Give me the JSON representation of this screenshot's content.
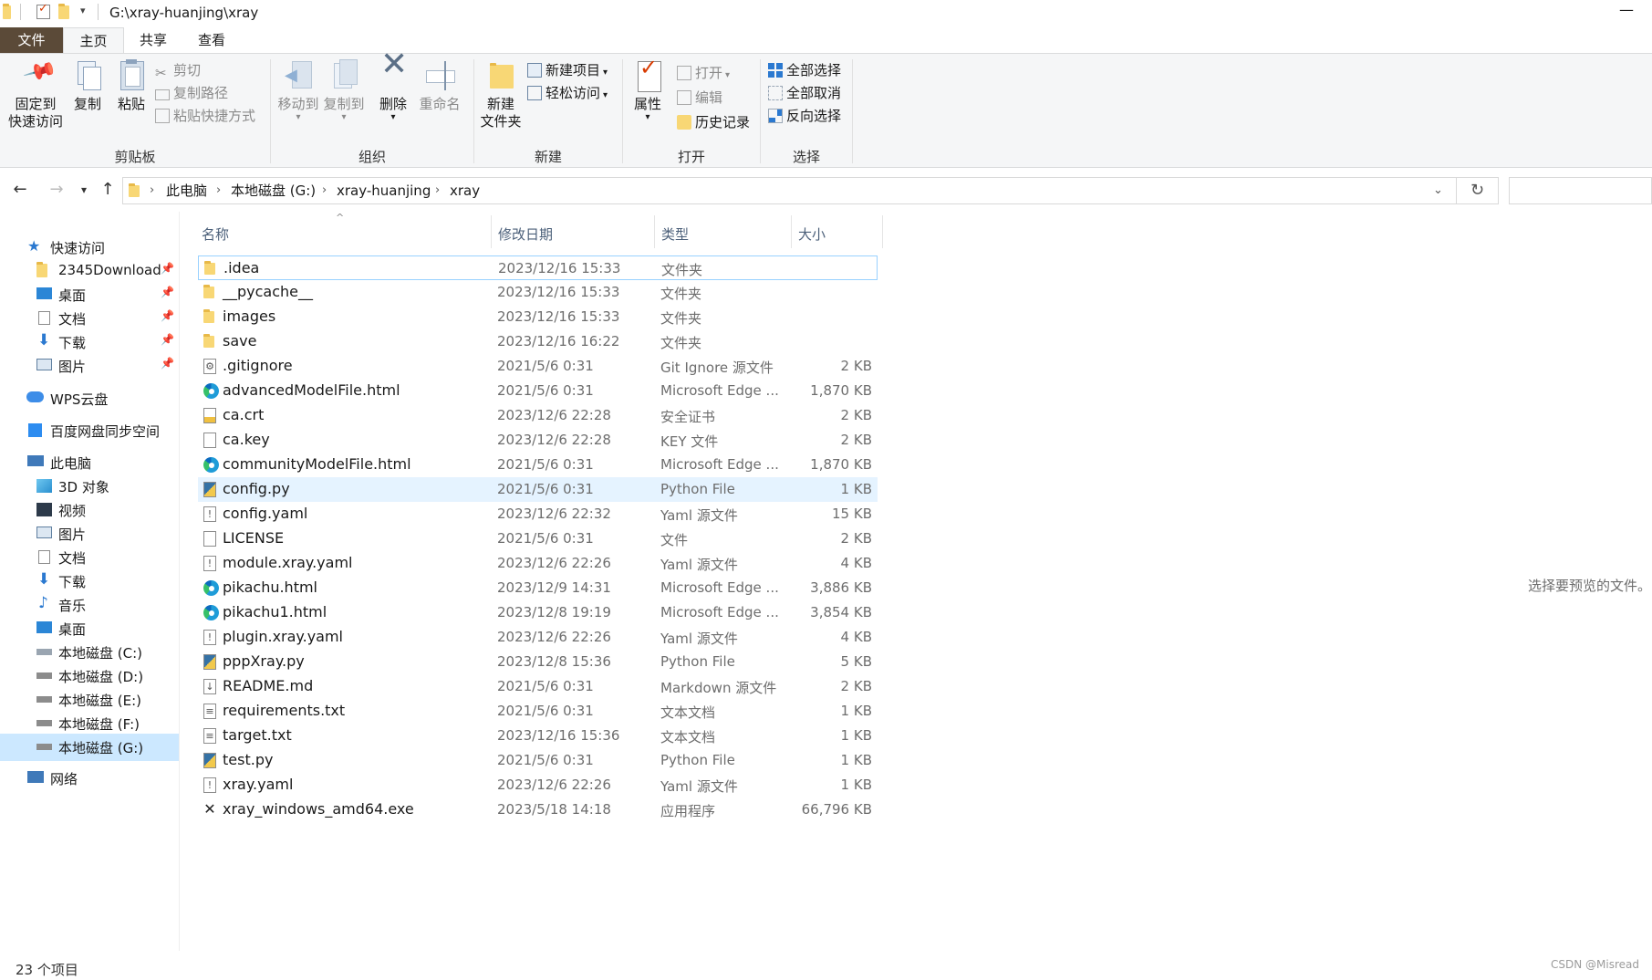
{
  "window": {
    "title": "G:\\xray-huanjing\\xray",
    "minimize_glyph": "—"
  },
  "ribbon": {
    "tabs": [
      "文件",
      "主页",
      "共享",
      "查看"
    ],
    "clipboard": {
      "pin_label_1": "固定到",
      "pin_label_2": "快速访问",
      "copy": "复制",
      "paste": "粘贴",
      "cut": "剪切",
      "copy_path": "复制路径",
      "paste_shortcut": "粘贴快捷方式",
      "group": "剪贴板"
    },
    "organize": {
      "move_to": "移动到",
      "copy_to": "复制到",
      "delete": "删除",
      "rename": "重命名",
      "group": "组织"
    },
    "new": {
      "new_folder_1": "新建",
      "new_folder_2": "文件夹",
      "new_item": "新建项目",
      "easy_access": "轻松访问",
      "group": "新建"
    },
    "open": {
      "properties": "属性",
      "open": "打开",
      "edit": "编辑",
      "history": "历史记录",
      "group": "打开"
    },
    "select": {
      "select_all": "全部选择",
      "select_none": "全部取消",
      "invert": "反向选择",
      "group": "选择"
    }
  },
  "address": {
    "crumbs": [
      "此电脑",
      "本地磁盘 (G:)",
      "xray-huanjing",
      "xray"
    ]
  },
  "nav": {
    "quick_access": "快速访问",
    "qa_items": [
      "2345Download",
      "桌面",
      "文档",
      "下载",
      "图片"
    ],
    "wps": "WPS云盘",
    "baidu": "百度网盘同步空间",
    "this_pc": "此电脑",
    "pc_items": [
      "3D 对象",
      "视频",
      "图片",
      "文档",
      "下载",
      "音乐",
      "桌面",
      "本地磁盘 (C:)",
      "本地磁盘 (D:)",
      "本地磁盘 (E:)",
      "本地磁盘 (F:)",
      "本地磁盘 (G:)"
    ],
    "network": "网络"
  },
  "columns": {
    "name": "名称",
    "date": "修改日期",
    "type": "类型",
    "size": "大小"
  },
  "files": [
    {
      "name": ".idea",
      "date": "2023/12/16 15:33",
      "type": "文件夹",
      "size": "",
      "icon": "folder-icon"
    },
    {
      "name": "__pycache__",
      "date": "2023/12/16 15:33",
      "type": "文件夹",
      "size": "",
      "icon": "folder-icon"
    },
    {
      "name": "images",
      "date": "2023/12/16 15:33",
      "type": "文件夹",
      "size": "",
      "icon": "folder-icon"
    },
    {
      "name": "save",
      "date": "2023/12/16 16:22",
      "type": "文件夹",
      "size": "",
      "icon": "folder-icon"
    },
    {
      "name": ".gitignore",
      "date": "2021/5/6 0:31",
      "type": "Git Ignore 源文件",
      "size": "2 KB",
      "icon": "settings-file-icon"
    },
    {
      "name": "advancedModelFile.html",
      "date": "2021/5/6 0:31",
      "type": "Microsoft Edge ...",
      "size": "1,870 KB",
      "icon": "edge-icon"
    },
    {
      "name": "ca.crt",
      "date": "2023/12/6 22:28",
      "type": "安全证书",
      "size": "2 KB",
      "icon": "certificate-icon"
    },
    {
      "name": "ca.key",
      "date": "2023/12/6 22:28",
      "type": "KEY 文件",
      "size": "2 KB",
      "icon": "blank-file-icon"
    },
    {
      "name": "communityModelFile.html",
      "date": "2021/5/6 0:31",
      "type": "Microsoft Edge ...",
      "size": "1,870 KB",
      "icon": "edge-icon"
    },
    {
      "name": "config.py",
      "date": "2021/5/6 0:31",
      "type": "Python File",
      "size": "1 KB",
      "icon": "python-file-icon"
    },
    {
      "name": "config.yaml",
      "date": "2023/12/6 22:32",
      "type": "Yaml 源文件",
      "size": "15 KB",
      "icon": "yaml-file-icon"
    },
    {
      "name": "LICENSE",
      "date": "2021/5/6 0:31",
      "type": "文件",
      "size": "2 KB",
      "icon": "blank-file-icon"
    },
    {
      "name": "module.xray.yaml",
      "date": "2023/12/6 22:26",
      "type": "Yaml 源文件",
      "size": "4 KB",
      "icon": "yaml-file-icon"
    },
    {
      "name": "pikachu.html",
      "date": "2023/12/9 14:31",
      "type": "Microsoft Edge ...",
      "size": "3,886 KB",
      "icon": "edge-icon"
    },
    {
      "name": "pikachu1.html",
      "date": "2023/12/8 19:19",
      "type": "Microsoft Edge ...",
      "size": "3,854 KB",
      "icon": "edge-icon"
    },
    {
      "name": "plugin.xray.yaml",
      "date": "2023/12/6 22:26",
      "type": "Yaml 源文件",
      "size": "4 KB",
      "icon": "yaml-file-icon"
    },
    {
      "name": "pppXray.py",
      "date": "2023/12/8 15:36",
      "type": "Python File",
      "size": "5 KB",
      "icon": "python-file-icon"
    },
    {
      "name": "README.md",
      "date": "2021/5/6 0:31",
      "type": "Markdown 源文件",
      "size": "2 KB",
      "icon": "markdown-file-icon"
    },
    {
      "name": "requirements.txt",
      "date": "2021/5/6 0:31",
      "type": "文本文档",
      "size": "1 KB",
      "icon": "text-file-icon"
    },
    {
      "name": "target.txt",
      "date": "2023/12/16 15:36",
      "type": "文本文档",
      "size": "1 KB",
      "icon": "text-file-icon"
    },
    {
      "name": "test.py",
      "date": "2021/5/6 0:31",
      "type": "Python File",
      "size": "1 KB",
      "icon": "python-file-icon"
    },
    {
      "name": "xray.yaml",
      "date": "2023/12/6 22:26",
      "type": "Yaml 源文件",
      "size": "1 KB",
      "icon": "yaml-file-icon"
    },
    {
      "name": "xray_windows_amd64.exe",
      "date": "2023/5/18 14:18",
      "type": "应用程序",
      "size": "66,796 KB",
      "icon": "executable-icon"
    }
  ],
  "preview": {
    "placeholder": "选择要预览的文件。"
  },
  "status": {
    "count": "23 个项目"
  },
  "watermark": "CSDN @Misread",
  "colors": {
    "file_tab": "#5b4a38",
    "ribbon_bg": "#f5f6f7",
    "selection_outline": "#99d1ff",
    "hover_row": "#e5f3ff",
    "nav_selected": "#cce8ff"
  }
}
